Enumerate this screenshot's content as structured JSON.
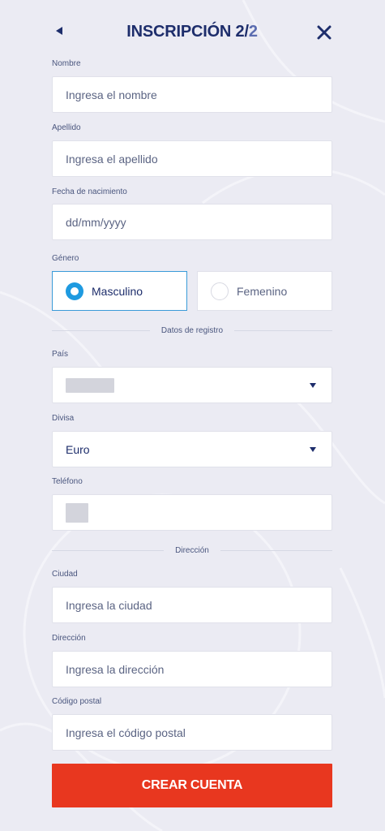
{
  "header": {
    "title_main": "INSCRIPCIÓN 2/",
    "title_total": "2"
  },
  "form": {
    "nombre": {
      "label": "Nombre",
      "placeholder": "Ingresa el nombre"
    },
    "apellido": {
      "label": "Apellido",
      "placeholder": "Ingresa el apellido"
    },
    "fecha": {
      "label": "Fecha de nacimiento",
      "placeholder": "dd/mm/yyyy"
    },
    "genero": {
      "label": "Género",
      "options": [
        {
          "label": "Masculino",
          "selected": true
        },
        {
          "label": "Femenino",
          "selected": false
        }
      ]
    },
    "section_registro": "Datos de registro",
    "pais": {
      "label": "País",
      "value": ""
    },
    "divisa": {
      "label": "Divisa",
      "value": "Euro"
    },
    "telefono": {
      "label": "Teléfono",
      "value": ""
    },
    "section_direccion": "Dirección",
    "ciudad": {
      "label": "Ciudad",
      "placeholder": "Ingresa la ciudad"
    },
    "direccion": {
      "label": "Dirección",
      "placeholder": "Ingresa la dirección"
    },
    "codigo_postal": {
      "label": "Código postal",
      "placeholder": "Ingresa el código postal"
    }
  },
  "cta": {
    "label": "CREAR CUENTA"
  },
  "colors": {
    "background": "#ebebf3",
    "text": "#1d2d6b",
    "accent_blue": "#1e9ae0",
    "cta_red": "#e8371f"
  },
  "icons": [
    "back-arrow-icon",
    "close-icon",
    "chevron-down-icon",
    "radio-selected-icon",
    "radio-empty-icon"
  ]
}
